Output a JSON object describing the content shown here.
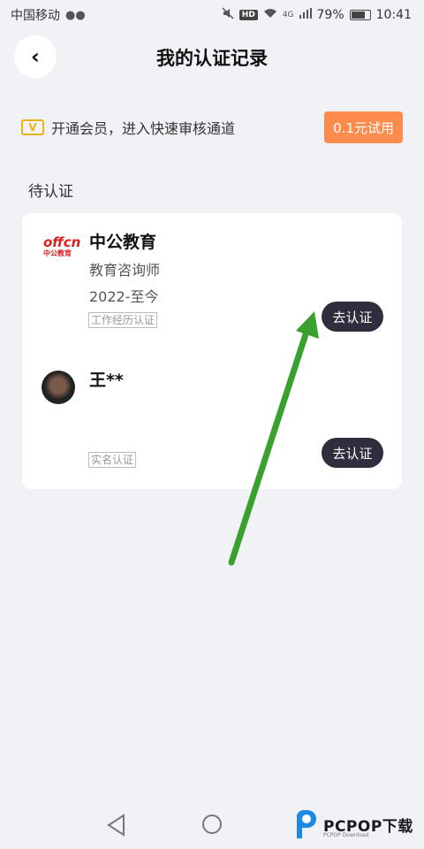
{
  "status_bar": {
    "carrier": "中国移动",
    "network": "4G",
    "battery": "79%",
    "battery_level": 0.79,
    "time": "10:41",
    "hd": "HD"
  },
  "header": {
    "title": "我的认证记录",
    "back_icon": "‹"
  },
  "vip_banner": {
    "icon_text": "V",
    "text": "开通会员，进入快速审核通道",
    "trial_button": "0.1元试用"
  },
  "section_title": "待认证",
  "records": [
    {
      "logo_top": "offcn",
      "logo_bottom": "中公教育",
      "name": "中公教育",
      "role": "教育咨询师",
      "period": "2022-至今",
      "tag": "工作经历认证",
      "action": "去认证"
    },
    {
      "name": "王**",
      "tag": "实名认证",
      "action": "去认证"
    }
  ],
  "watermark": {
    "text": "PCPOP下载",
    "sub": "PCPOP Download"
  },
  "colors": {
    "accent": "#fb8c4d",
    "button_dark": "#2f2e3e",
    "vip_gold": "#e9b21a",
    "annotation_arrow": "#3aa12f"
  }
}
